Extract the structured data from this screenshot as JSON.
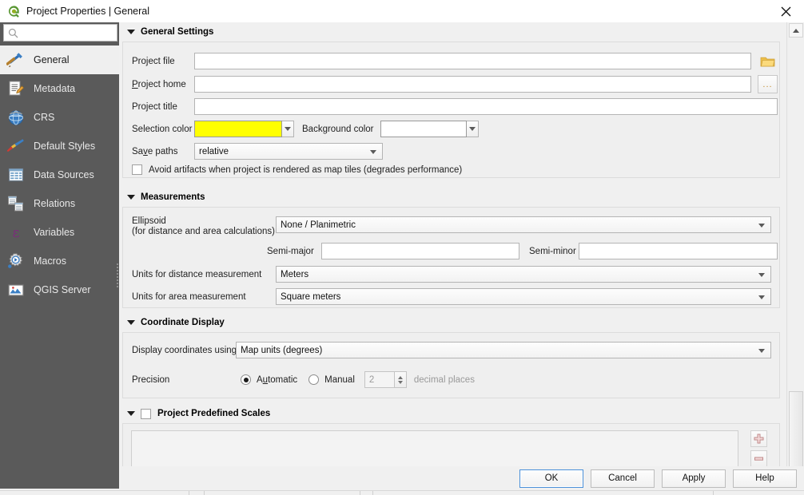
{
  "window": {
    "title": "Project Properties | General",
    "app_icon": "qgis-logo-icon",
    "close_label": "✕"
  },
  "sidebar": {
    "search": {
      "placeholder": "",
      "value": "",
      "icon": "search-icon"
    },
    "items": [
      {
        "label": "General",
        "icon": "tools-icon",
        "selected": true
      },
      {
        "label": "Metadata",
        "icon": "document-edit-icon",
        "selected": false
      },
      {
        "label": "CRS",
        "icon": "globe-icon",
        "selected": false
      },
      {
        "label": "Default Styles",
        "icon": "paintbrush-icon",
        "selected": false
      },
      {
        "label": "Data Sources",
        "icon": "table-icon",
        "selected": false
      },
      {
        "label": "Relations",
        "icon": "relations-icon",
        "selected": false
      },
      {
        "label": "Variables",
        "icon": "epsilon-icon",
        "selected": false
      },
      {
        "label": "Macros",
        "icon": "gear-play-icon",
        "selected": false
      },
      {
        "label": "QGIS Server",
        "icon": "server-map-icon",
        "selected": false
      }
    ]
  },
  "general_settings": {
    "title": "General Settings",
    "project_file": {
      "label": "Project file",
      "value": "",
      "browse_icon": "folder-open-icon"
    },
    "project_home": {
      "label": "Project home",
      "value": "",
      "browse_label": "..."
    },
    "project_title": {
      "label": "Project title",
      "value": ""
    },
    "selection_color": {
      "label": "Selection color",
      "value": "#ffff00"
    },
    "background_color": {
      "label": "Background color",
      "value": "#ffffff"
    },
    "save_paths": {
      "label": "Save paths",
      "value": "relative"
    },
    "avoid_artifacts": {
      "label": "Avoid artifacts when project is rendered as map tiles (degrades performance)",
      "checked": false
    }
  },
  "measurements": {
    "title": "Measurements",
    "ellipsoid": {
      "label_line1": "Ellipsoid",
      "label_line2": "(for distance and area calculations)",
      "value": "None / Planimetric"
    },
    "semi_major": {
      "label": "Semi-major",
      "value": ""
    },
    "semi_minor": {
      "label": "Semi-minor",
      "value": ""
    },
    "distance_units": {
      "label": "Units for distance measurement",
      "value": "Meters"
    },
    "area_units": {
      "label": "Units for area measurement",
      "value": "Square meters"
    }
  },
  "coordinate_display": {
    "title": "Coordinate Display",
    "display_using": {
      "label": "Display coordinates using",
      "value": "Map units (degrees)"
    },
    "precision": {
      "label": "Precision",
      "automatic_label": "Automatic",
      "manual_label": "Manual",
      "selected": "Automatic",
      "decimals_value": "2",
      "decimals_label": "decimal places"
    }
  },
  "predefined_scales": {
    "title": "Project Predefined Scales",
    "checked": false,
    "items": [],
    "add_icon": "plus-icon",
    "remove_icon": "minus-icon"
  },
  "buttons": {
    "ok": "OK",
    "cancel": "Cancel",
    "apply": "Apply",
    "help": "Help"
  },
  "colors": {
    "sidebar_bg": "#5a5a5a",
    "content_bg": "#f0f0f0",
    "selection_yellow": "#ffff00",
    "default_button_border": "#4a90d9"
  }
}
